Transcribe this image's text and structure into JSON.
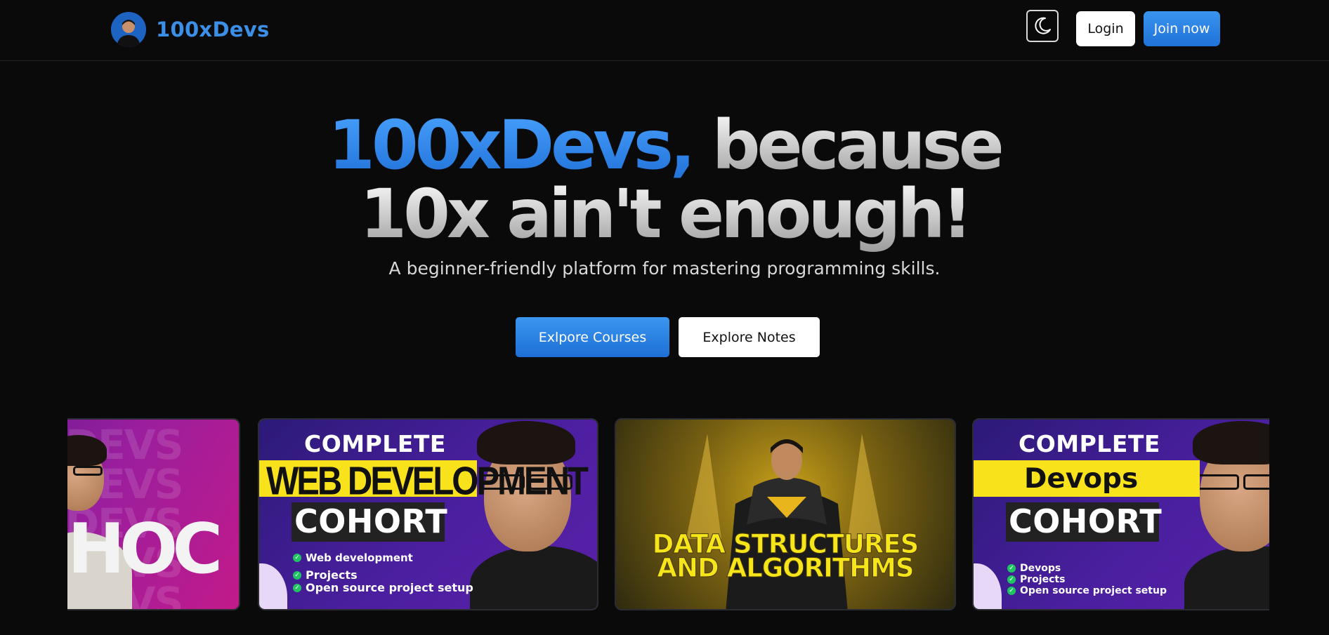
{
  "navbar": {
    "brand_name": "100xDevs",
    "avatar_icon": "user-avatar",
    "theme_toggle_icon": "moon-icon",
    "login_label": "Login",
    "join_label": "Join now",
    "accent_color": "#3b8fe6"
  },
  "hero": {
    "title_highlight": "100xDevs,",
    "title_rest": " because",
    "title_line2": "10x ain't enough!",
    "subtitle": "A beginner-friendly platform for mastering programming skills.",
    "primary_button": "Exlpore Courses",
    "secondary_button": "Explore Notes"
  },
  "courses": [
    {
      "bg_text": "DEVS",
      "title": "HOC"
    },
    {
      "top_text": "COMPLETE",
      "band_text": "WEB DEVELOPMENT",
      "cohort_text": "COHORT",
      "bullets": [
        "Web development",
        "Projects",
        "Open source project setup"
      ]
    },
    {
      "title_line1": "DATA STRUCTURES",
      "title_line2": "AND ALGORITHMS"
    },
    {
      "top_text": "COMPLETE",
      "band_text": "Devops",
      "cohort_text": "COHORT",
      "bullets": [
        "Devops",
        "Projects",
        "Open source project setup"
      ]
    }
  ]
}
